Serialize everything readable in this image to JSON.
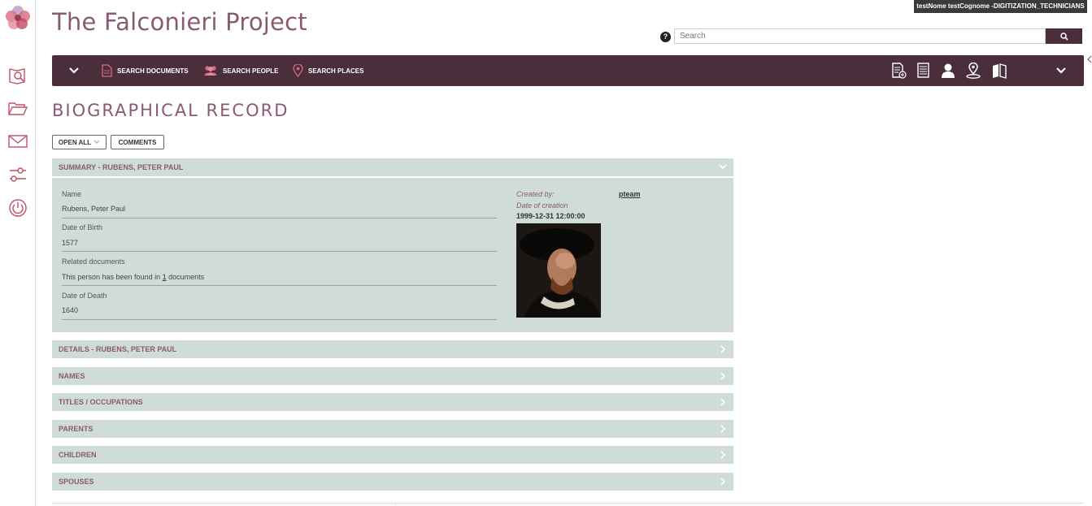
{
  "app": {
    "title": "The Falconieri Project"
  },
  "user": {
    "badge": "testNome testCognome -DIGITIZATION_TECHNICIANS"
  },
  "header": {
    "help_icon": "question-circle-icon",
    "search_placeholder": "Search",
    "search_icon": "magnifier-icon"
  },
  "sidebar": {
    "logo": "flower-logo",
    "icons": [
      "document-search-icon",
      "folder-open-icon",
      "envelope-icon",
      "sliders-icon",
      "power-icon"
    ]
  },
  "navbar": {
    "items": [
      {
        "label": "SEARCH DOCUMENTS",
        "icon": "document-icon"
      },
      {
        "label": "SEARCH PEOPLE",
        "icon": "people-icon"
      },
      {
        "label": "SEARCH PLACES",
        "icon": "map-pin-icon"
      }
    ],
    "right_icons": [
      "add-document-icon",
      "document-list-icon",
      "person-icon",
      "place-pin-icon",
      "book-icon"
    ]
  },
  "page": {
    "heading": "BIOGRAPHICAL RECORD"
  },
  "buttons": {
    "open_all": "OPEN ALL",
    "comments": "COMMENTS"
  },
  "summary": {
    "title": "SUMMARY - RUBENS, PETER PAUL",
    "fields": [
      {
        "label": "Name",
        "value": "Rubens, Peter Paul"
      },
      {
        "label": "Date of Birth",
        "value": "1577"
      },
      {
        "label": "Related documents",
        "value_prefix": "This person has been found in ",
        "value_link": "1",
        "value_suffix": " documents"
      },
      {
        "label": "Date of Death",
        "value": "1640"
      }
    ],
    "created_by_label": "Created by:",
    "created_by_value": "pteam",
    "date_of_creation_label": "Date of creation",
    "date_of_creation_value": "1999-12-31 12:00:00"
  },
  "sections": [
    "DETAILS - RUBENS, PETER PAUL",
    "NAMES",
    "TITLES / OCCUPATIONS",
    "PARENTS",
    "CHILDREN",
    "SPOUSES"
  ],
  "colors": {
    "brand": "#8a5a73",
    "navbar": "#4a2e3b",
    "panel": "#cfdcd7",
    "sidebar_icons": "#c0506a"
  }
}
